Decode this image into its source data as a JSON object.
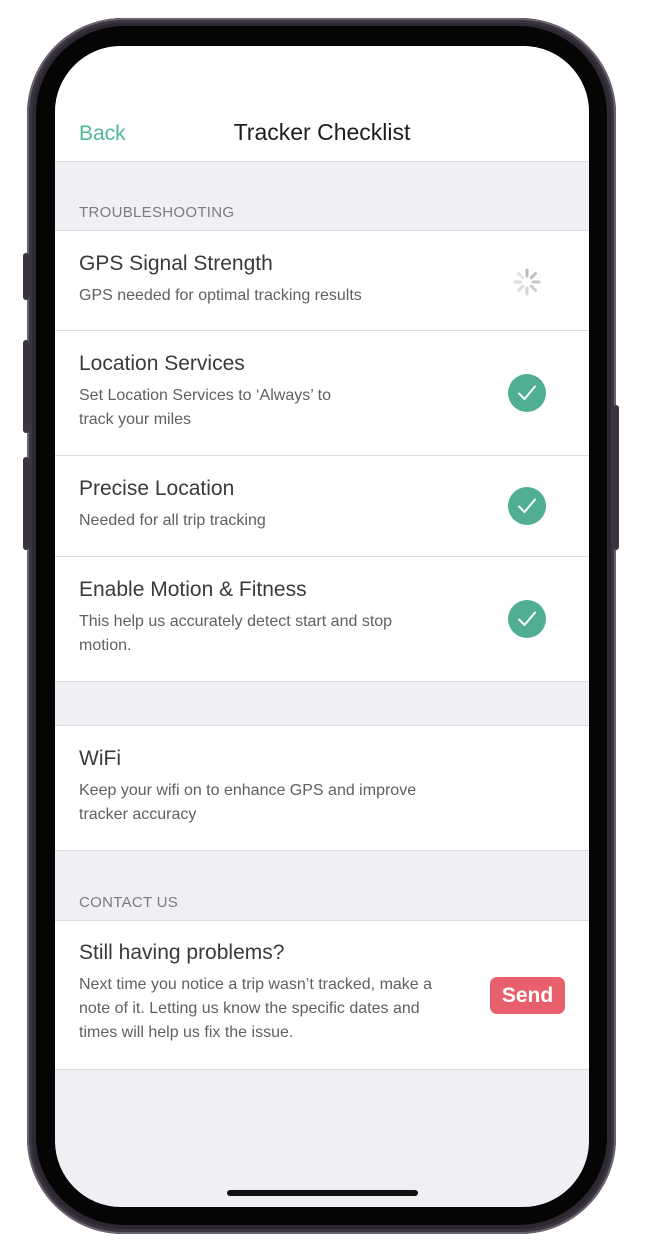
{
  "nav": {
    "back_label": "Back",
    "title": "Tracker Checklist"
  },
  "troubleshooting": {
    "header": "TROUBLESHOOTING",
    "items": [
      {
        "title": "GPS Signal Strength",
        "subtitle": "GPS needed for optimal tracking results",
        "status": "loading-spinner"
      },
      {
        "title": "Location Services",
        "subtitle": "Set Location Services to ‘Always’ to track your miles",
        "status": "checkmark"
      },
      {
        "title": "Precise Location",
        "subtitle": "Needed for all trip tracking",
        "status": "checkmark"
      },
      {
        "title": "Enable Motion & Fitness",
        "subtitle": "This help us accurately detect start and stop motion.",
        "status": "checkmark"
      }
    ]
  },
  "wifi": {
    "title": "WiFi",
    "subtitle": "Keep your wifi on to enhance GPS and improve tracker accuracy"
  },
  "contact": {
    "header": "CONTACT US",
    "title": "Still having problems?",
    "subtitle": "Next time you notice a trip wasn’t tracked, make a note of it. Letting us know the specific dates and times will help us fix the issue.",
    "send_label": "Send"
  },
  "colors": {
    "accent": "#4fb89a",
    "check": "#4fae94",
    "send": "#e8606b",
    "background": "#f0eff4"
  }
}
